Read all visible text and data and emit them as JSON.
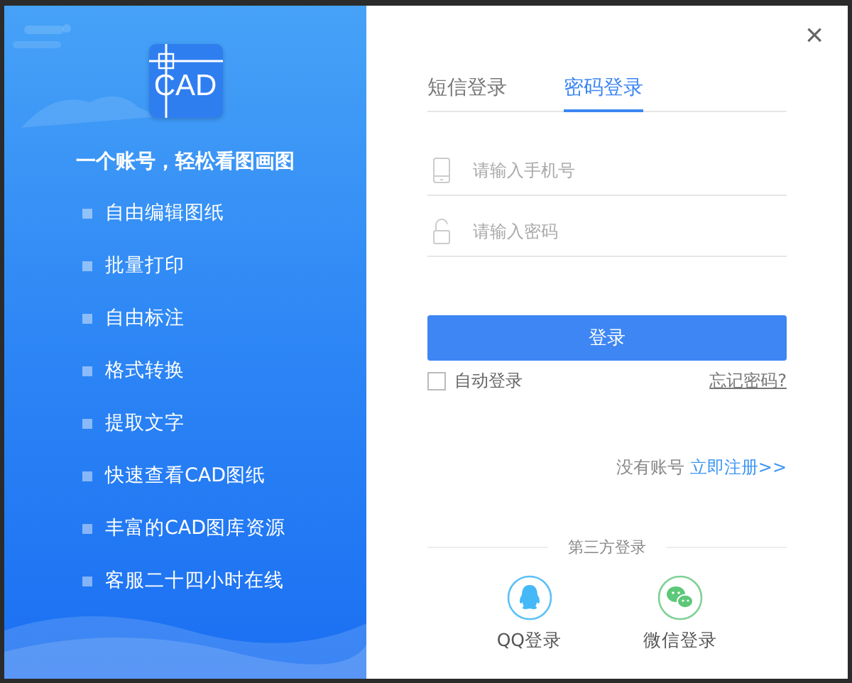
{
  "brand": {
    "logo_text": "CAD",
    "tagline": "一个账号，轻松看图画图"
  },
  "features": [
    "自由编辑图纸",
    "批量打印",
    "自由标注",
    "格式转换",
    "提取文字",
    "快速查看CAD图纸",
    "丰富的CAD图库资源",
    "客服二十四小时在线"
  ],
  "close": "×",
  "tabs": [
    {
      "label": "短信登录",
      "selected": false
    },
    {
      "label": "密码登录",
      "selected": true
    }
  ],
  "fields": [
    {
      "kind": "phone",
      "placeholder": "请输入手机号"
    },
    {
      "kind": "password",
      "placeholder": "请输入密码"
    }
  ],
  "login_button": "登录",
  "auto_login": {
    "label": "自动登录",
    "checked": false
  },
  "forgot_link": "忘记密码?",
  "register": {
    "prompt": "没有账号",
    "link": "立即注册>>"
  },
  "third_party": {
    "title": "第三方登录",
    "options": [
      {
        "kind": "qq",
        "label": "QQ登录"
      },
      {
        "kind": "wechat",
        "label": "微信登录"
      }
    ]
  }
}
